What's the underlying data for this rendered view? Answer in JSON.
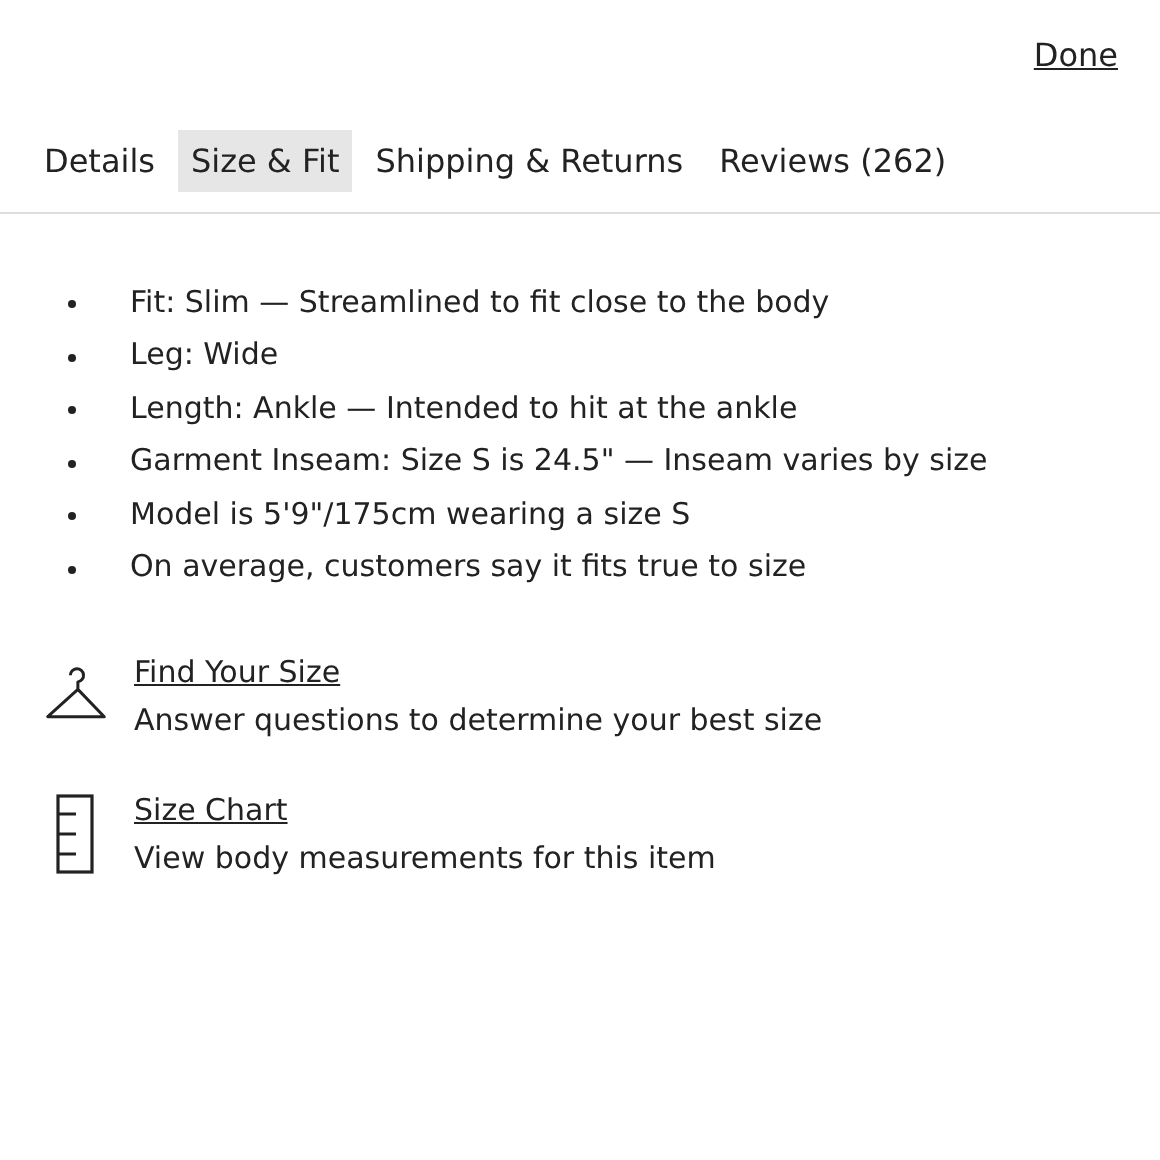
{
  "done_link": "Done",
  "tabs": [
    {
      "label": "Details",
      "selected": false
    },
    {
      "label": "Size & Fit",
      "selected": true
    },
    {
      "label": "Shipping & Returns",
      "selected": false
    },
    {
      "label": "Reviews (262)",
      "selected": false
    }
  ],
  "fit_notes": [
    "Fit: Slim — Streamlined to fit close to the body",
    "Leg: Wide",
    "Length: Ankle — Intended to hit at the ankle",
    "Garment Inseam: Size S is 24.5\" — Inseam varies by size",
    "Model is 5'9\"/175cm wearing a size S",
    "On average, customers say it fits true to size"
  ],
  "tools": [
    {
      "kind": "hanger",
      "title": "Find Your Size",
      "description": "Answer questions to determine your best size"
    },
    {
      "kind": "ruler",
      "title": "Size Chart",
      "description": "View body measurements for this item"
    }
  ]
}
